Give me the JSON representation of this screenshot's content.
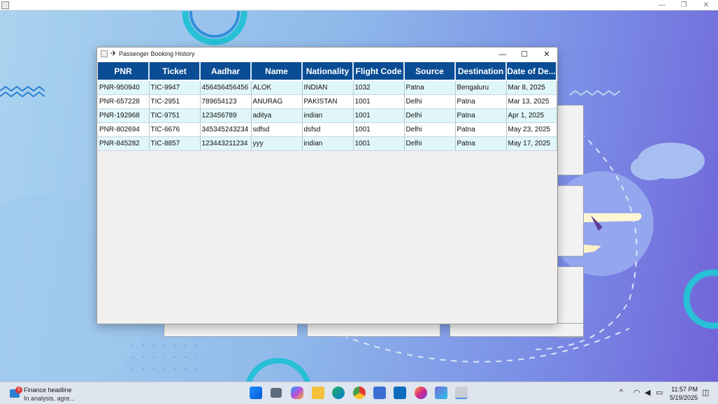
{
  "outer_window": {
    "minimize": "—",
    "restore": "❐",
    "close": "✕"
  },
  "dialog": {
    "title": "Passenger Booking History",
    "minimize": "—",
    "maximize": "☐",
    "close": "✕"
  },
  "table": {
    "columns": [
      "PNR",
      "Ticket",
      "Aadhar",
      "Name",
      "Nationality",
      "Flight Code",
      "Source",
      "Destination",
      "Date of De..."
    ],
    "rows": [
      [
        "PNR-950940",
        "TIC-9947",
        "456456456456",
        "ALOK",
        "INDIAN",
        "1032",
        "Patna",
        "Bengaluru",
        "Mar 8, 2025"
      ],
      [
        "PNR-657228",
        "TIC-2951",
        "789654123",
        "ANURAG",
        "PAKISTAN",
        "1001",
        "Delhi",
        "Patna",
        "Mar 13, 2025"
      ],
      [
        "PNR-192968",
        "TIC-9751",
        "123456789",
        "aditya",
        "indian",
        "1001",
        "Delhi",
        "Patna",
        "Apr 1, 2025"
      ],
      [
        "PNR-802694",
        "TIC-6676",
        "345345243234",
        "sdfsd",
        "dsfsd",
        "1001",
        "Delhi",
        "Patna",
        "May 23, 2025"
      ],
      [
        "PNR-845282",
        "TIC-8857",
        "123443211234",
        "yyy",
        "indian",
        "1001",
        "Delhi",
        "Patna",
        "May 17, 2025"
      ]
    ]
  },
  "taskbar": {
    "news_badge": "3",
    "news_headline": "Finance headline",
    "news_sub": "In analysis, agre...",
    "tray_chevron": "^",
    "time": "11:57 PM",
    "date": "5/19/2025",
    "icons": [
      "windows-start-icon",
      "task-view-icon",
      "copilot-icon",
      "file-explorer-icon",
      "edge-icon",
      "chrome-icon",
      "store-icon",
      "outlook-icon",
      "firefox-icon",
      "app-icon",
      "java-icon"
    ]
  },
  "colors": {
    "header_bg": "#0a4d94",
    "row_alt": "#e1f6f8"
  }
}
